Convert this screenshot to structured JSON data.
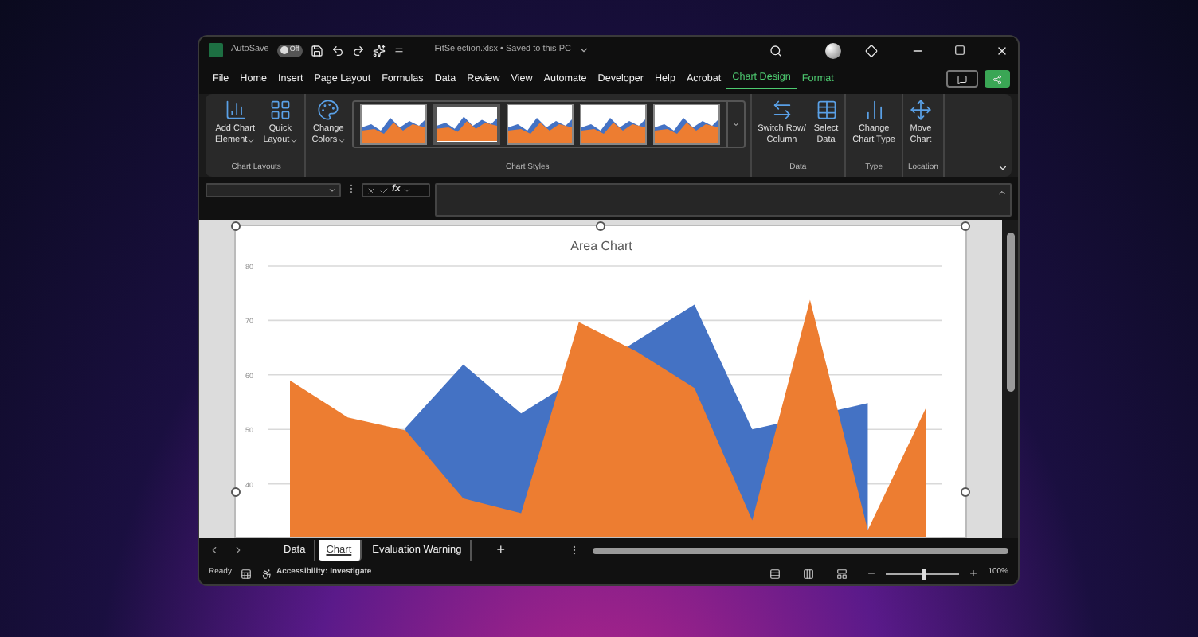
{
  "title_bar": {
    "autosave_label": "AutoSave",
    "autosave_toggle": {
      "label": "Off",
      "on": false
    },
    "document_title": "FitSelection.xlsx • Saved to this PC"
  },
  "ribbon_tabs": [
    {
      "label": "File",
      "selected": false,
      "contextual": false
    },
    {
      "label": "Home",
      "selected": false,
      "contextual": false
    },
    {
      "label": "Insert",
      "selected": false,
      "contextual": false
    },
    {
      "label": "Page Layout",
      "selected": false,
      "contextual": false
    },
    {
      "label": "Formulas",
      "selected": false,
      "contextual": false
    },
    {
      "label": "Data",
      "selected": false,
      "contextual": false
    },
    {
      "label": "Review",
      "selected": false,
      "contextual": false
    },
    {
      "label": "View",
      "selected": false,
      "contextual": false
    },
    {
      "label": "Automate",
      "selected": false,
      "contextual": false
    },
    {
      "label": "Developer",
      "selected": false,
      "contextual": false
    },
    {
      "label": "Help",
      "selected": false,
      "contextual": false
    },
    {
      "label": "Acrobat",
      "selected": false,
      "contextual": false
    },
    {
      "label": "Chart Design",
      "selected": true,
      "contextual": true
    },
    {
      "label": "Format",
      "selected": false,
      "contextual": true
    }
  ],
  "ribbon_groups": [
    {
      "label": "Chart Layouts",
      "commands": [
        {
          "kind": "button",
          "lines": [
            "Add Chart",
            "Element"
          ],
          "dropdown": true
        },
        {
          "kind": "button",
          "lines": [
            "Quick",
            "Layout"
          ],
          "dropdown": true
        }
      ]
    },
    {
      "label": "Chart Styles",
      "commands": [
        {
          "kind": "button",
          "lines": [
            "Change",
            "Colors"
          ],
          "dropdown": true
        },
        {
          "kind": "gallery",
          "styles": [
            {
              "selected": false
            },
            {
              "selected": true
            },
            {
              "selected": false
            },
            {
              "selected": false
            },
            {
              "selected": false
            }
          ]
        }
      ]
    },
    {
      "label": "Data",
      "commands": [
        {
          "kind": "button",
          "lines": [
            "Switch Row/",
            "Column"
          ],
          "dropdown": false
        },
        {
          "kind": "button",
          "lines": [
            "Select",
            "Data"
          ],
          "dropdown": false
        }
      ]
    },
    {
      "label": "Type",
      "commands": [
        {
          "kind": "button",
          "lines": [
            "Change",
            "Chart Type"
          ],
          "dropdown": false
        }
      ]
    },
    {
      "label": "Location",
      "commands": [
        {
          "kind": "button",
          "lines": [
            "Move",
            "Chart"
          ],
          "dropdown": false
        }
      ]
    }
  ],
  "formula_bar": {
    "function_label": "fx"
  },
  "chart": {
    "chart_data": {
      "type": "area",
      "title": "Area Chart",
      "series": [
        {
          "color": "#4472c4",
          "values": [
            null,
            null,
            50.3,
            61.9,
            52.9,
            null,
            null,
            72.9,
            50,
            null,
            54.8,
            null
          ]
        },
        {
          "color": "#ed7d31",
          "values": [
            59,
            52.2,
            49.8,
            37.3,
            34.6,
            69.7,
            64.3,
            57.6,
            33.3,
            73.8,
            31.5,
            53.8
          ]
        }
      ],
      "ylim": [
        30,
        80
      ],
      "yticks": [
        40,
        50,
        60,
        70,
        80
      ],
      "grid": true
    }
  },
  "sheet_tabs": [
    {
      "label": "Data",
      "selected": false
    },
    {
      "label": "Chart",
      "selected": true
    },
    {
      "label": "Evaluation Warning",
      "selected": false
    }
  ],
  "add_sheet": "+",
  "status_bar": {
    "mode": "Ready",
    "accessibility": "Accessibility: Investigate",
    "zoom": {
      "level": 0.5,
      "reading": "100%"
    }
  }
}
